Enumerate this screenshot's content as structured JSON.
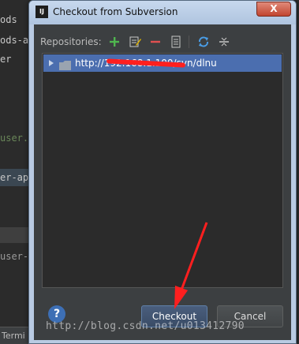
{
  "ide": {
    "lines": [
      "ods",
      "ods-a",
      "er",
      "user.i",
      "er-ap",
      "user-a"
    ],
    "status_tab": "Termi"
  },
  "dialog": {
    "title": "Checkout from Subversion",
    "app_icon": "IJ",
    "close_symbol": "X",
    "repositories_label": "Repositories:",
    "toolbar_icons": [
      "add-icon",
      "edit-icon",
      "remove-icon",
      "browse-icon",
      "refresh-icon",
      "collapse-icon"
    ],
    "repository": {
      "url": "http://192.168.1.100/svn/dlnu",
      "selected": true
    },
    "help_label": "?",
    "checkout_label": "Checkout",
    "cancel_label": "Cancel"
  },
  "watermark": "http://blog.csdn.net/u013412790",
  "colors": {
    "selection": "#4b6eaf",
    "panel": "#3c3f41",
    "annotation_red": "#ff1f1f"
  }
}
